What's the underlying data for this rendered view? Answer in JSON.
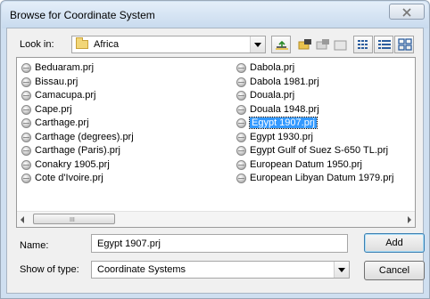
{
  "dialog": {
    "title": "Browse for Coordinate System"
  },
  "lookin": {
    "label": "Look in:",
    "value": "Africa"
  },
  "toolbar": {
    "icons": [
      "up-folder-icon",
      "connect-folder-icon",
      "disconnect-folder-icon",
      "new-folder-icon",
      "list-view-icon",
      "details-view-icon",
      "thumbnails-view-icon"
    ]
  },
  "files": {
    "col1": [
      "Beduaram.prj",
      "Bissau.prj",
      "Camacupa.prj",
      "Cape.prj",
      "Carthage.prj",
      "Carthage (degrees).prj",
      "Carthage (Paris).prj",
      "Conakry 1905.prj",
      "Cote d'Ivoire.prj"
    ],
    "col2": [
      "Dabola.prj",
      "Dabola 1981.prj",
      "Douala.prj",
      "Douala 1948.prj",
      "Egypt 1907.prj",
      "Egypt 1930.prj",
      "Egypt Gulf of Suez S-650 TL.prj",
      "European Datum 1950.prj",
      "European Libyan Datum 1979.prj"
    ],
    "selected": "Egypt 1907.prj",
    "scrollbar_grip": "III"
  },
  "name": {
    "label": "Name:",
    "value": "Egypt 1907.prj"
  },
  "type": {
    "label": "Show of type:",
    "value": "Coordinate Systems"
  },
  "buttons": {
    "add": "Add",
    "cancel": "Cancel",
    "close": "☒"
  }
}
